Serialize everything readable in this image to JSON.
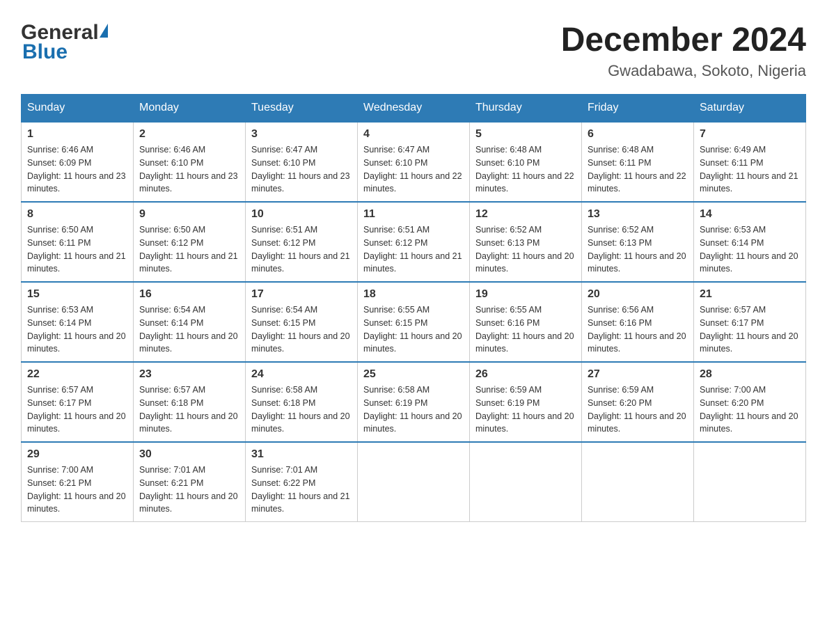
{
  "header": {
    "logo_general": "General",
    "logo_blue": "Blue",
    "title": "December 2024",
    "subtitle": "Gwadabawa, Sokoto, Nigeria"
  },
  "days_of_week": [
    "Sunday",
    "Monday",
    "Tuesday",
    "Wednesday",
    "Thursday",
    "Friday",
    "Saturday"
  ],
  "weeks": [
    [
      {
        "date": "1",
        "sunrise": "Sunrise: 6:46 AM",
        "sunset": "Sunset: 6:09 PM",
        "daylight": "Daylight: 11 hours and 23 minutes."
      },
      {
        "date": "2",
        "sunrise": "Sunrise: 6:46 AM",
        "sunset": "Sunset: 6:10 PM",
        "daylight": "Daylight: 11 hours and 23 minutes."
      },
      {
        "date": "3",
        "sunrise": "Sunrise: 6:47 AM",
        "sunset": "Sunset: 6:10 PM",
        "daylight": "Daylight: 11 hours and 23 minutes."
      },
      {
        "date": "4",
        "sunrise": "Sunrise: 6:47 AM",
        "sunset": "Sunset: 6:10 PM",
        "daylight": "Daylight: 11 hours and 22 minutes."
      },
      {
        "date": "5",
        "sunrise": "Sunrise: 6:48 AM",
        "sunset": "Sunset: 6:10 PM",
        "daylight": "Daylight: 11 hours and 22 minutes."
      },
      {
        "date": "6",
        "sunrise": "Sunrise: 6:48 AM",
        "sunset": "Sunset: 6:11 PM",
        "daylight": "Daylight: 11 hours and 22 minutes."
      },
      {
        "date": "7",
        "sunrise": "Sunrise: 6:49 AM",
        "sunset": "Sunset: 6:11 PM",
        "daylight": "Daylight: 11 hours and 21 minutes."
      }
    ],
    [
      {
        "date": "8",
        "sunrise": "Sunrise: 6:50 AM",
        "sunset": "Sunset: 6:11 PM",
        "daylight": "Daylight: 11 hours and 21 minutes."
      },
      {
        "date": "9",
        "sunrise": "Sunrise: 6:50 AM",
        "sunset": "Sunset: 6:12 PM",
        "daylight": "Daylight: 11 hours and 21 minutes."
      },
      {
        "date": "10",
        "sunrise": "Sunrise: 6:51 AM",
        "sunset": "Sunset: 6:12 PM",
        "daylight": "Daylight: 11 hours and 21 minutes."
      },
      {
        "date": "11",
        "sunrise": "Sunrise: 6:51 AM",
        "sunset": "Sunset: 6:12 PM",
        "daylight": "Daylight: 11 hours and 21 minutes."
      },
      {
        "date": "12",
        "sunrise": "Sunrise: 6:52 AM",
        "sunset": "Sunset: 6:13 PM",
        "daylight": "Daylight: 11 hours and 20 minutes."
      },
      {
        "date": "13",
        "sunrise": "Sunrise: 6:52 AM",
        "sunset": "Sunset: 6:13 PM",
        "daylight": "Daylight: 11 hours and 20 minutes."
      },
      {
        "date": "14",
        "sunrise": "Sunrise: 6:53 AM",
        "sunset": "Sunset: 6:14 PM",
        "daylight": "Daylight: 11 hours and 20 minutes."
      }
    ],
    [
      {
        "date": "15",
        "sunrise": "Sunrise: 6:53 AM",
        "sunset": "Sunset: 6:14 PM",
        "daylight": "Daylight: 11 hours and 20 minutes."
      },
      {
        "date": "16",
        "sunrise": "Sunrise: 6:54 AM",
        "sunset": "Sunset: 6:14 PM",
        "daylight": "Daylight: 11 hours and 20 minutes."
      },
      {
        "date": "17",
        "sunrise": "Sunrise: 6:54 AM",
        "sunset": "Sunset: 6:15 PM",
        "daylight": "Daylight: 11 hours and 20 minutes."
      },
      {
        "date": "18",
        "sunrise": "Sunrise: 6:55 AM",
        "sunset": "Sunset: 6:15 PM",
        "daylight": "Daylight: 11 hours and 20 minutes."
      },
      {
        "date": "19",
        "sunrise": "Sunrise: 6:55 AM",
        "sunset": "Sunset: 6:16 PM",
        "daylight": "Daylight: 11 hours and 20 minutes."
      },
      {
        "date": "20",
        "sunrise": "Sunrise: 6:56 AM",
        "sunset": "Sunset: 6:16 PM",
        "daylight": "Daylight: 11 hours and 20 minutes."
      },
      {
        "date": "21",
        "sunrise": "Sunrise: 6:57 AM",
        "sunset": "Sunset: 6:17 PM",
        "daylight": "Daylight: 11 hours and 20 minutes."
      }
    ],
    [
      {
        "date": "22",
        "sunrise": "Sunrise: 6:57 AM",
        "sunset": "Sunset: 6:17 PM",
        "daylight": "Daylight: 11 hours and 20 minutes."
      },
      {
        "date": "23",
        "sunrise": "Sunrise: 6:57 AM",
        "sunset": "Sunset: 6:18 PM",
        "daylight": "Daylight: 11 hours and 20 minutes."
      },
      {
        "date": "24",
        "sunrise": "Sunrise: 6:58 AM",
        "sunset": "Sunset: 6:18 PM",
        "daylight": "Daylight: 11 hours and 20 minutes."
      },
      {
        "date": "25",
        "sunrise": "Sunrise: 6:58 AM",
        "sunset": "Sunset: 6:19 PM",
        "daylight": "Daylight: 11 hours and 20 minutes."
      },
      {
        "date": "26",
        "sunrise": "Sunrise: 6:59 AM",
        "sunset": "Sunset: 6:19 PM",
        "daylight": "Daylight: 11 hours and 20 minutes."
      },
      {
        "date": "27",
        "sunrise": "Sunrise: 6:59 AM",
        "sunset": "Sunset: 6:20 PM",
        "daylight": "Daylight: 11 hours and 20 minutes."
      },
      {
        "date": "28",
        "sunrise": "Sunrise: 7:00 AM",
        "sunset": "Sunset: 6:20 PM",
        "daylight": "Daylight: 11 hours and 20 minutes."
      }
    ],
    [
      {
        "date": "29",
        "sunrise": "Sunrise: 7:00 AM",
        "sunset": "Sunset: 6:21 PM",
        "daylight": "Daylight: 11 hours and 20 minutes."
      },
      {
        "date": "30",
        "sunrise": "Sunrise: 7:01 AM",
        "sunset": "Sunset: 6:21 PM",
        "daylight": "Daylight: 11 hours and 20 minutes."
      },
      {
        "date": "31",
        "sunrise": "Sunrise: 7:01 AM",
        "sunset": "Sunset: 6:22 PM",
        "daylight": "Daylight: 11 hours and 21 minutes."
      },
      null,
      null,
      null,
      null
    ]
  ]
}
